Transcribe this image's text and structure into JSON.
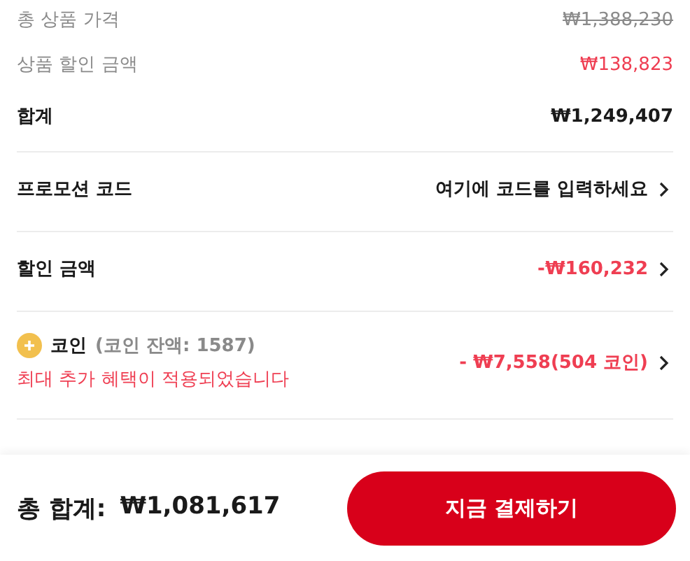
{
  "rows": [
    {
      "kind": "original",
      "label": "총 상품 가격",
      "value": "₩1,388,230"
    },
    {
      "kind": "savings",
      "label": "상품 할인 금액",
      "value": "₩138,823"
    },
    {
      "kind": "subtotal",
      "label": "합계",
      "value": "₩1,249,407"
    },
    {
      "kind": "link",
      "label": "프로모션 코드",
      "value": "여기에 코드를 입력하세요"
    },
    {
      "kind": "discount",
      "label": "할인 금액",
      "value": "-₩160,232"
    },
    {
      "kind": "coin",
      "label": "코인",
      "balance": "(코인 잔액: 1587)",
      "note": "최대 추가 혜택이 적용되었습니다",
      "value": "- ₩7,558(504 코인)"
    }
  ],
  "footer": {
    "total_label": "총 합계:",
    "total": "₩1,081,617",
    "button": "지금 결제하기"
  }
}
